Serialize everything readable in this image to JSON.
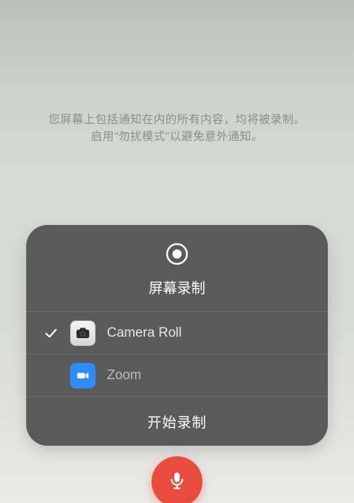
{
  "info": {
    "line1": "您屏幕上包括通知在内的所有内容，均将被录制。",
    "line2": "启用\"勿扰模式\"以避免意外通知。"
  },
  "panel": {
    "title": "屏幕录制",
    "options": [
      {
        "label": "Camera Roll",
        "selected": true,
        "icon": "camera-roll"
      },
      {
        "label": "Zoom",
        "selected": false,
        "icon": "zoom"
      }
    ],
    "start_label": "开始录制"
  },
  "colors": {
    "panel_bg": "#5a5a5a",
    "accent_red": "#e74c3c",
    "zoom_blue": "#2d8cff"
  },
  "icons": {
    "record": "record-target-icon",
    "check": "checkmark-icon",
    "camera": "camera-icon",
    "zoom_cam": "videocam-icon",
    "mic": "microphone-icon"
  }
}
